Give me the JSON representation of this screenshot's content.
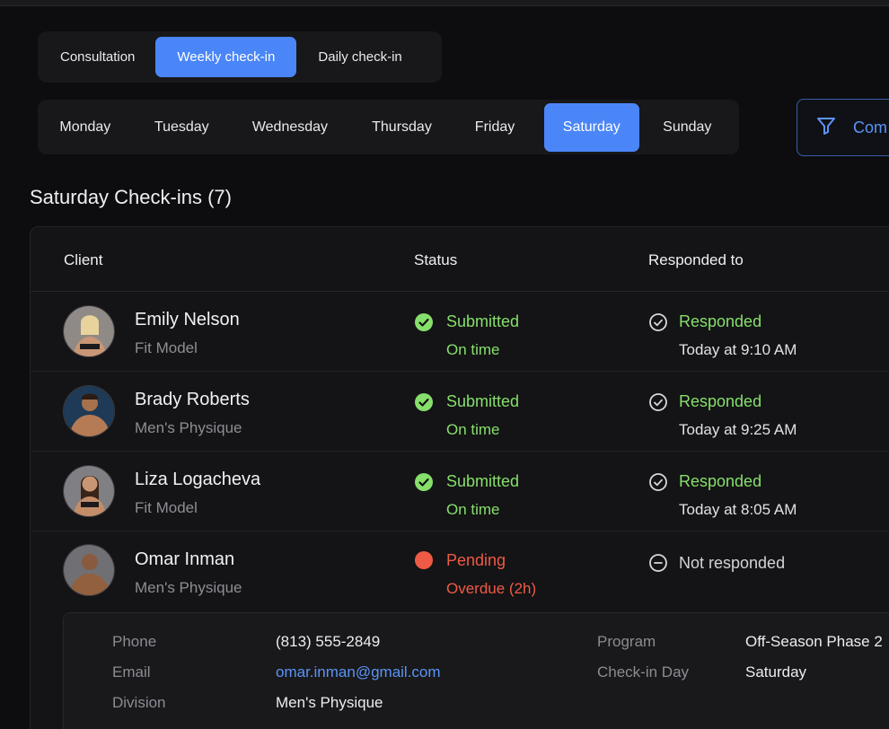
{
  "checkin_types": [
    {
      "label": "Consultation",
      "active": false
    },
    {
      "label": "Weekly check-in",
      "active": true
    },
    {
      "label": "Daily check-in",
      "active": false
    }
  ],
  "days": [
    {
      "label": "Monday",
      "active": false
    },
    {
      "label": "Tuesday",
      "active": false
    },
    {
      "label": "Wednesday",
      "active": false
    },
    {
      "label": "Thursday",
      "active": false
    },
    {
      "label": "Friday",
      "active": false
    },
    {
      "label": "Saturday",
      "active": true
    },
    {
      "label": "Sunday",
      "active": false
    }
  ],
  "filter": {
    "label": "Com",
    "icon": "filter-icon"
  },
  "section_title": "Saturday Check-ins (7)",
  "table": {
    "headers": {
      "client": "Client",
      "status": "Status",
      "responded": "Responded to"
    },
    "rows": [
      {
        "name": "Emily Nelson",
        "division": "Fit Model",
        "status": "Submitted",
        "status_sub": "On time",
        "status_kind": "ok",
        "responded": "Responded",
        "responded_sub": "Today at 9:10 AM",
        "responded_kind": "ok"
      },
      {
        "name": "Brady Roberts",
        "division": "Men's Physique",
        "status": "Submitted",
        "status_sub": "On time",
        "status_kind": "ok",
        "responded": "Responded",
        "responded_sub": "Today at 9:25 AM",
        "responded_kind": "ok"
      },
      {
        "name": "Liza Logacheva",
        "division": "Fit Model",
        "status": "Submitted",
        "status_sub": "On time",
        "status_kind": "ok",
        "responded": "Responded",
        "responded_sub": "Today at 8:05 AM",
        "responded_kind": "ok"
      },
      {
        "name": "Omar Inman",
        "division": "Men's Physique",
        "status": "Pending",
        "status_sub": "Overdue (2h)",
        "status_kind": "pending",
        "responded": "Not responded",
        "responded_sub": "",
        "responded_kind": "none"
      }
    ]
  },
  "details": {
    "phone_label": "Phone",
    "phone": "(813) 555-2849",
    "email_label": "Email",
    "email": "omar.inman@gmail.com",
    "division_label": "Division",
    "division": "Men's Physique",
    "program_label": "Program",
    "program": "Off-Season Phase 2",
    "checkin_day_label": "Check-in Day",
    "checkin_day": "Saturday"
  },
  "colors": {
    "accent": "#4a86f7",
    "success": "#86df6b",
    "danger": "#ef5a45"
  }
}
